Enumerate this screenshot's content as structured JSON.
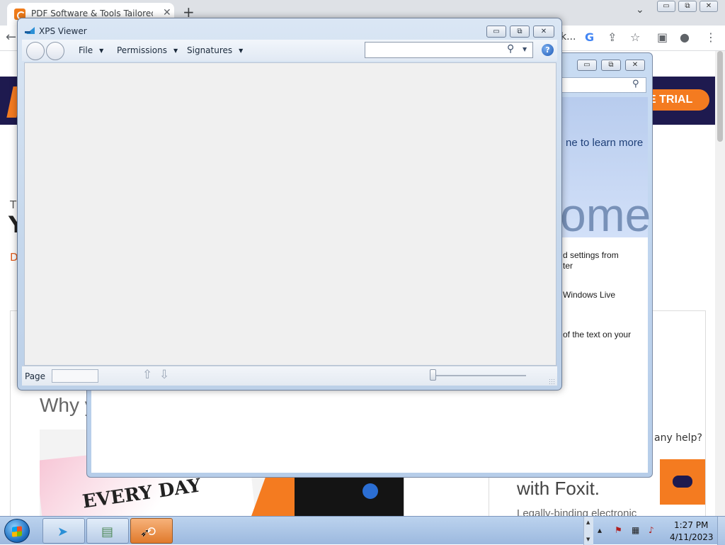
{
  "browser": {
    "tab_title": "PDF Software & Tools Tailored to",
    "tab_close": "✕",
    "new_tab": "+",
    "tab_list_caret": "⌄",
    "win_minimize": "▭",
    "win_restore": "⧉",
    "win_close": "✕",
    "back": "←",
    "url_fragment": "k...",
    "trial_button": "E TRIAL",
    "icons": [
      "google-icon",
      "share-icon",
      "star-icon",
      "sidepanel-icon",
      "profile-icon",
      "more-icon"
    ]
  },
  "website": {
    "frag_t": "T",
    "frag_y": "Y",
    "frag_d": "D",
    "why_heading": "Why y",
    "collage_text": "EVERY DAY",
    "with_foxit": "with Foxit.",
    "legal_text": "Legally-binding electronic",
    "help_prompt": "any help?",
    "brand_orange": "#f47b20",
    "brand_navy": "#1e1a4f"
  },
  "windows_live": {
    "btn_minimize": "▭",
    "btn_maximize": "⧉",
    "btn_close": "✕",
    "learn_more": "ne to learn more",
    "big_text": "ome",
    "settings_line1": "d settings from",
    "settings_line2": "ter",
    "windows_live_line": "Windows Live",
    "text_line": "of the text on your"
  },
  "xps_viewer": {
    "title": "XPS Viewer",
    "btn_minimize": "▭",
    "btn_maximize": "⧉",
    "btn_close": "✕",
    "menus": {
      "file": "File",
      "permissions": "Permissions",
      "signatures": "Signatures"
    },
    "menu_caret": "▼",
    "search": {
      "value": "",
      "placeholder": ""
    },
    "search_glyph": "⚲",
    "search_dropdown": "▼",
    "help_glyph": "?",
    "status": {
      "page_label": "Page",
      "page_value": "",
      "up_arrow": "⇧",
      "down_arrow": "⇩",
      "zoom_level": 0
    }
  },
  "taskbar": {
    "clock_time": "1:27 PM",
    "clock_date": "4/11/2023",
    "tray_up": "▲",
    "tray_down": "▼",
    "tray_arrow": "▴",
    "tray_icons": [
      "action-center-icon",
      "network-icon",
      "volume-muted-icon"
    ]
  }
}
